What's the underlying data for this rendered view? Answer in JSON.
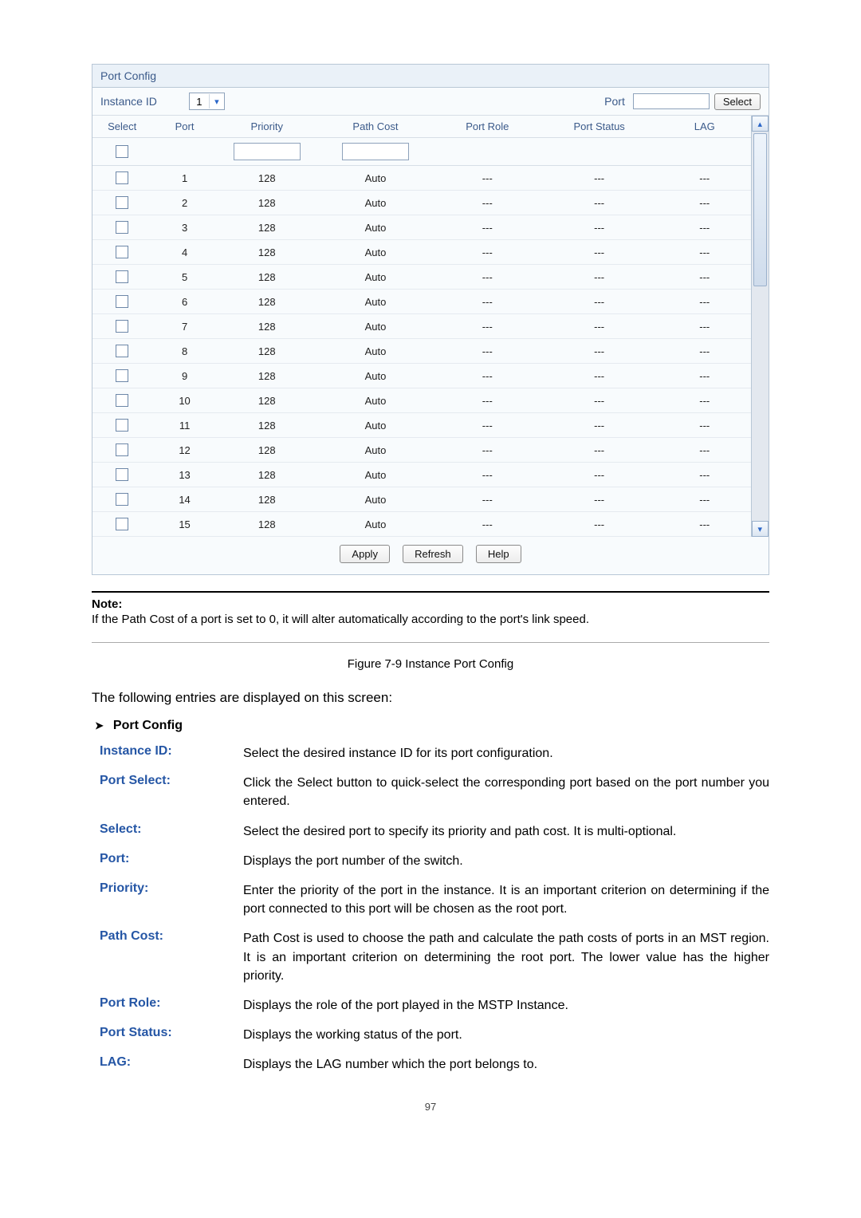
{
  "panel": {
    "title": "Port Config",
    "instance_label": "Instance ID",
    "instance_value": "1",
    "port_label": "Port",
    "port_input": "",
    "select_btn": "Select",
    "headers": {
      "select": "Select",
      "port": "Port",
      "priority": "Priority",
      "path_cost": "Path Cost",
      "port_role": "Port Role",
      "port_status": "Port Status",
      "lag": "LAG"
    },
    "filter_row": {
      "priority": "",
      "path_cost": ""
    },
    "rows": [
      {
        "port": "1",
        "priority": "128",
        "path_cost": "Auto",
        "port_role": "---",
        "port_status": "---",
        "lag": "---"
      },
      {
        "port": "2",
        "priority": "128",
        "path_cost": "Auto",
        "port_role": "---",
        "port_status": "---",
        "lag": "---"
      },
      {
        "port": "3",
        "priority": "128",
        "path_cost": "Auto",
        "port_role": "---",
        "port_status": "---",
        "lag": "---"
      },
      {
        "port": "4",
        "priority": "128",
        "path_cost": "Auto",
        "port_role": "---",
        "port_status": "---",
        "lag": "---"
      },
      {
        "port": "5",
        "priority": "128",
        "path_cost": "Auto",
        "port_role": "---",
        "port_status": "---",
        "lag": "---"
      },
      {
        "port": "6",
        "priority": "128",
        "path_cost": "Auto",
        "port_role": "---",
        "port_status": "---",
        "lag": "---"
      },
      {
        "port": "7",
        "priority": "128",
        "path_cost": "Auto",
        "port_role": "---",
        "port_status": "---",
        "lag": "---"
      },
      {
        "port": "8",
        "priority": "128",
        "path_cost": "Auto",
        "port_role": "---",
        "port_status": "---",
        "lag": "---"
      },
      {
        "port": "9",
        "priority": "128",
        "path_cost": "Auto",
        "port_role": "---",
        "port_status": "---",
        "lag": "---"
      },
      {
        "port": "10",
        "priority": "128",
        "path_cost": "Auto",
        "port_role": "---",
        "port_status": "---",
        "lag": "---"
      },
      {
        "port": "11",
        "priority": "128",
        "path_cost": "Auto",
        "port_role": "---",
        "port_status": "---",
        "lag": "---"
      },
      {
        "port": "12",
        "priority": "128",
        "path_cost": "Auto",
        "port_role": "---",
        "port_status": "---",
        "lag": "---"
      },
      {
        "port": "13",
        "priority": "128",
        "path_cost": "Auto",
        "port_role": "---",
        "port_status": "---",
        "lag": "---"
      },
      {
        "port": "14",
        "priority": "128",
        "path_cost": "Auto",
        "port_role": "---",
        "port_status": "---",
        "lag": "---"
      },
      {
        "port": "15",
        "priority": "128",
        "path_cost": "Auto",
        "port_role": "---",
        "port_status": "---",
        "lag": "---"
      }
    ],
    "buttons": {
      "apply": "Apply",
      "refresh": "Refresh",
      "help": "Help"
    }
  },
  "note": {
    "label": "Note:",
    "text": "If the Path Cost of a port is set to 0, it will alter automatically according to the port's link speed."
  },
  "figure_caption": "Figure 7-9 Instance Port Config",
  "intro": "The following entries are displayed on this screen:",
  "section_title": "Port Config",
  "defs": [
    {
      "k": "Instance ID:",
      "v": "Select the desired instance ID for its port configuration."
    },
    {
      "k": "Port Select:",
      "v": "Click the Select button to quick-select the corresponding port based on the port number you entered."
    },
    {
      "k": "Select:",
      "v": "Select the desired port to specify its priority and path cost. It is multi-optional."
    },
    {
      "k": "Port:",
      "v": "Displays the port number of the switch."
    },
    {
      "k": "Priority:",
      "v": "Enter the priority of the port in the instance. It is an important criterion on determining if the port connected to this port will be chosen as the root port."
    },
    {
      "k": "Path Cost:",
      "v": "Path Cost is used to choose the path and calculate the path costs of ports in an MST region. It is an important criterion on determining the root port. The lower value has the higher priority."
    },
    {
      "k": "Port Role:",
      "v": "Displays the role of the port played in the MSTP Instance."
    },
    {
      "k": "Port Status:",
      "v": "Displays the working status of the port."
    },
    {
      "k": "LAG:",
      "v": "Displays the LAG number which the port belongs to."
    }
  ],
  "page_number": "97"
}
